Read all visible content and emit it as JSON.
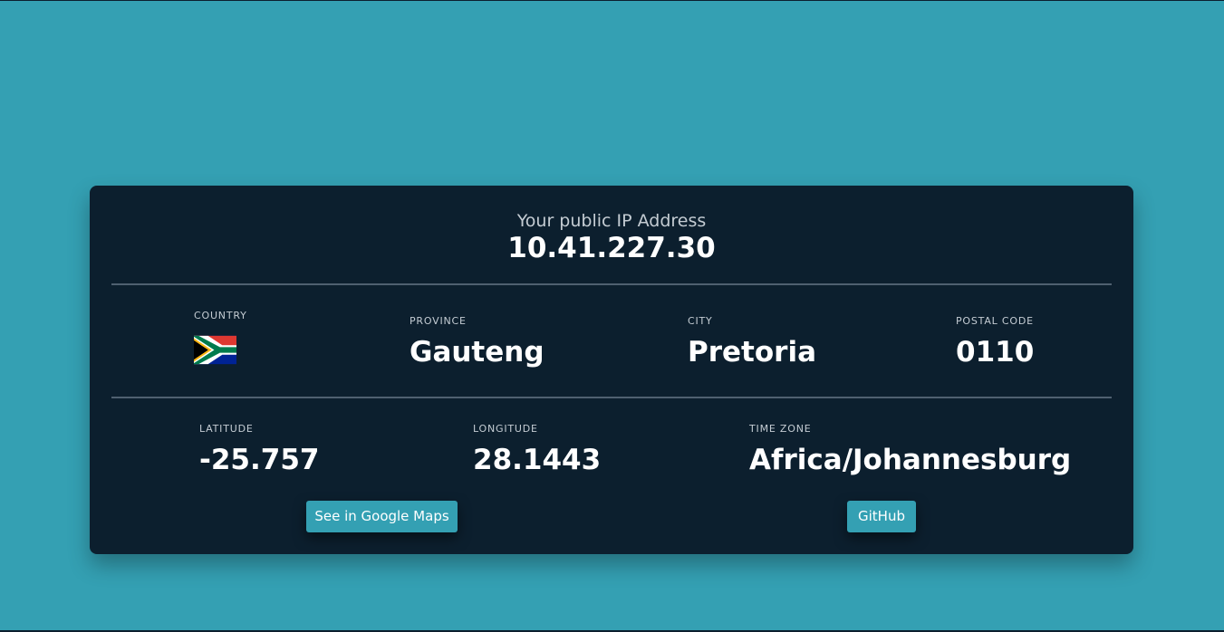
{
  "ip": {
    "label": "Your public IP Address",
    "value": "10.41.227.30"
  },
  "location": {
    "country_label": "COUNTRY",
    "country_flag": "south-africa-flag",
    "province_label": "PROVINCE",
    "province_value": "Gauteng",
    "city_label": "CITY",
    "city_value": "Pretoria",
    "postal_label": "POSTAL CODE",
    "postal_value": "0110"
  },
  "coords": {
    "latitude_label": "LATITUDE",
    "latitude_value": "-25.757",
    "longitude_label": "LONGITUDE",
    "longitude_value": "28.1443",
    "timezone_label": "TIME ZONE",
    "timezone_value": "Africa/Johannesburg"
  },
  "actions": {
    "maps_label": "See in Google Maps",
    "github_label": "GitHub"
  },
  "colors": {
    "background": "#34a0b3",
    "card": "#0c1f2e",
    "accent": "#34a0b3"
  }
}
